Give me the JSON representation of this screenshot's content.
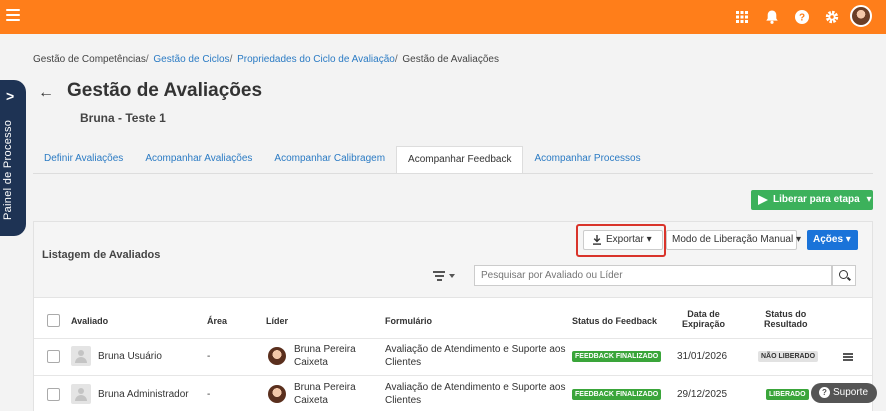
{
  "header": {
    "icons": [
      "apps-grid-icon",
      "bell-icon",
      "help-icon",
      "gear-icon"
    ],
    "accent_color": "#ff7e1a"
  },
  "side_panel": {
    "label": "Painel de Processo"
  },
  "breadcrumb": {
    "item1": "Gestão de Competências",
    "item2": "Gestão de Ciclos",
    "item3": "Propriedades do Ciclo de Avaliação",
    "item4": "Gestão de Avaliações",
    "sep": "/"
  },
  "page": {
    "title": "Gestão de Avaliações",
    "subtitle": "Bruna - Teste 1"
  },
  "tabs": [
    {
      "label": "Definir Avaliações"
    },
    {
      "label": "Acompanhar Avaliações"
    },
    {
      "label": "Acompanhar Calibragem"
    },
    {
      "label": "Acompanhar Feedback"
    },
    {
      "label": "Acompanhar Processos"
    }
  ],
  "actions": {
    "liberar_label": "Liberar para etapa",
    "exportar_label": "Exportar",
    "modo_label": "Modo de Liberação Manual",
    "acoes_label": "Ações",
    "caret": "▾"
  },
  "list": {
    "title": "Listagem de Avaliados",
    "search_placeholder": "Pesquisar por Avaliado ou Líder",
    "columns": {
      "avaliado": "Avaliado",
      "area": "Área",
      "lider": "Líder",
      "formulario": "Formulário",
      "status_feedback": "Status do Feedback",
      "data_exp_1": "Data de",
      "data_exp_2": "Expiração",
      "status_res_1": "Status do",
      "status_res_2": "Resultado"
    },
    "rows": [
      {
        "avaliado": "Bruna Usuário",
        "area": "-",
        "lider_1": "Bruna Pereira",
        "lider_2": "Caixeta",
        "form_1": "Avaliação de Atendimento e Suporte aos",
        "form_2": "Clientes",
        "status_feedback": "FEEDBACK FINALIZADO",
        "data": "31/01/2026",
        "status_resultado": "NÃO LIBERADO"
      },
      {
        "avaliado": "Bruna Administrador",
        "area": "-",
        "lider_1": "Bruna Pereira",
        "lider_2": "Caixeta",
        "form_1": "Avaliação de Atendimento e Suporte aos",
        "form_2": "Clientes",
        "status_feedback": "FEEDBACK FINALIZADO",
        "data": "29/12/2025",
        "status_resultado": "LIBERADO"
      }
    ]
  },
  "support": {
    "label": "Suporte"
  }
}
